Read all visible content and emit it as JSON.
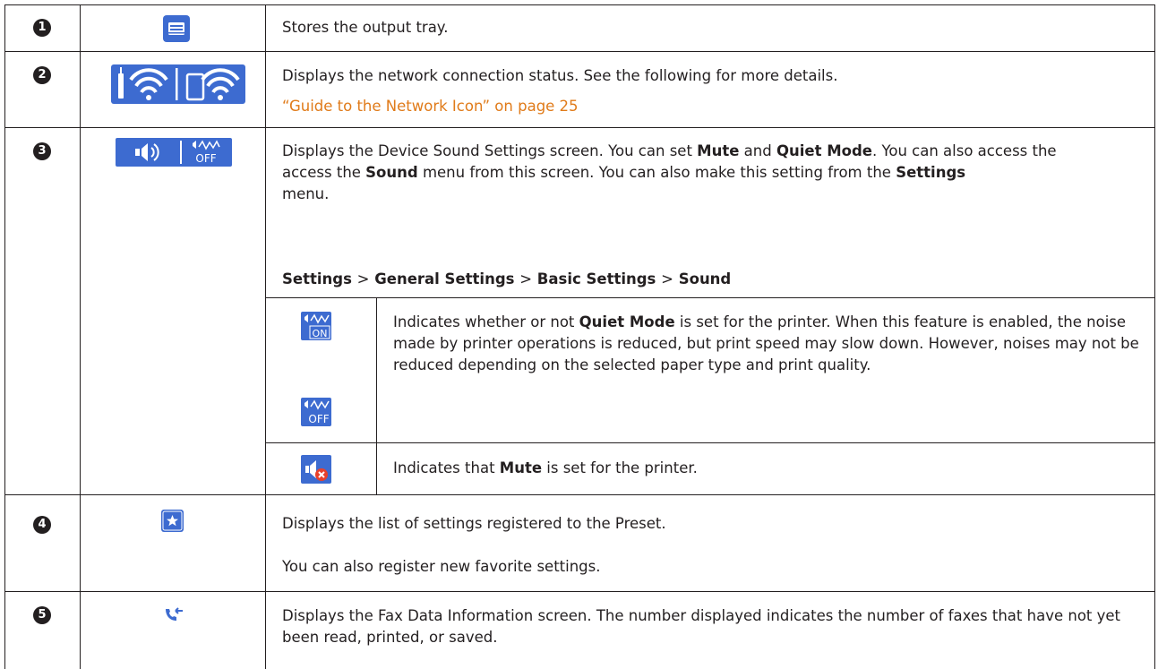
{
  "rows": [
    {
      "number": "1",
      "icon": "output-tray-icon",
      "description": "Stores the output tray."
    },
    {
      "number": "2",
      "icons": [
        "wifi-router-icon",
        "wifi-direct-icon"
      ],
      "description": "Displays the network connection status. See the following for more details.",
      "link_text": "“Guide to the Network Icon” on page 25"
    },
    {
      "number": "3",
      "icons": [
        "speaker-icon",
        "quiet-mode-off-icon"
      ],
      "description": {
        "p1": "Displays the Device Sound Settings screen. You can set ",
        "mute": "Mute",
        "p2": " and ",
        "quiet_mode": "Quiet Mode",
        "p3": ". You can also access the ",
        "sound": "Sound",
        "p4": " menu from this screen. You can also make this setting from the ",
        "settings": "Settings",
        "p5": " menu."
      },
      "path": {
        "settings": "Settings",
        "sep": ">",
        "general_settings": "General Settings",
        "basic_settings": "Basic Settings",
        "sound": "Sound"
      },
      "sub_rows": [
        {
          "icons": [
            "quiet-mode-on-icon",
            "quiet-mode-off-icon"
          ],
          "p1": "Indicates whether or not ",
          "bold": "Quiet Mode",
          "p2": " is set for the printer. When this feature is enabled, the noise made by printer operations is reduced, but print speed may slow down. However, noises may not be reduced depending on the selected paper type and print quality."
        },
        {
          "icon": "mute-icon",
          "p1": "Indicates that ",
          "bold": "Mute",
          "p2": " is set for the printer."
        }
      ],
      "icon_labels": {
        "on": "ON",
        "off": "OFF"
      }
    },
    {
      "number": "4",
      "icon": "star-preset-icon",
      "description": "Displays the list of settings registered to the Preset.",
      "description2": "You can also register new favorite settings."
    },
    {
      "number": "5",
      "icon": "fax-data-icon",
      "description": "Displays the Fax Data Information screen. The number displayed indicates the number of faxes that have not yet been read, printed, or saved."
    }
  ],
  "colors": {
    "icon_blue": "#3d6bd0",
    "link": "#e07b1a",
    "text": "#231f20"
  }
}
